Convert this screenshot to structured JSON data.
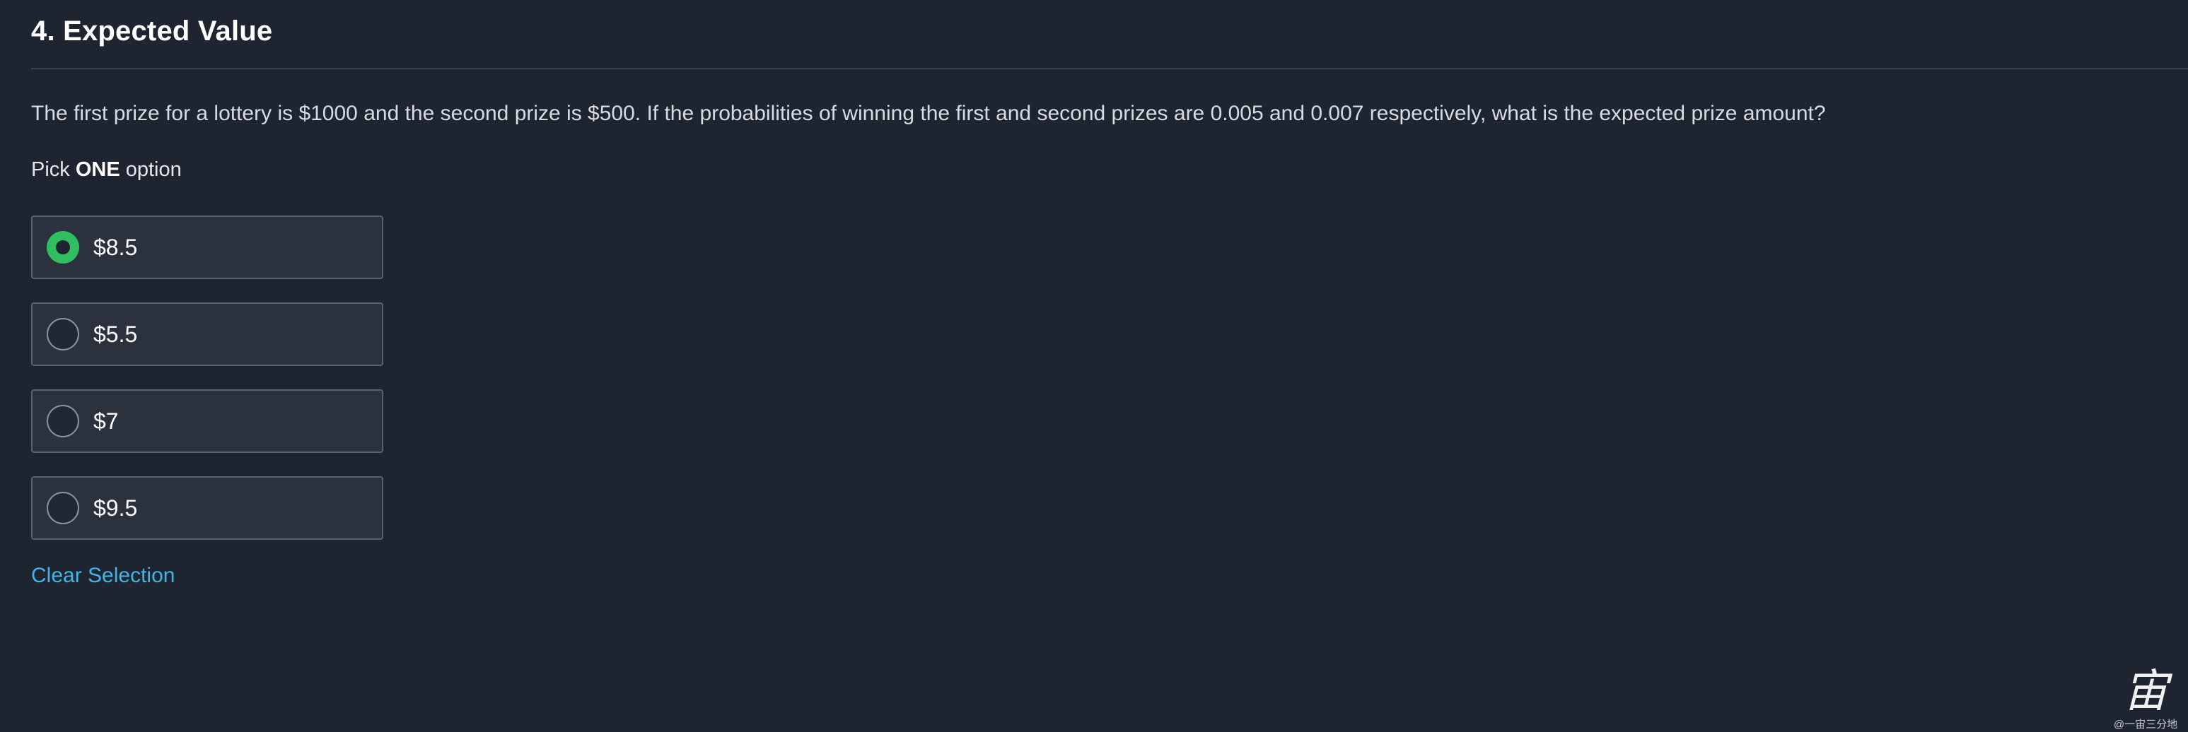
{
  "question": {
    "title": "4. Expected Value",
    "text": "The first prize for a lottery is $1000 and the second prize is $500. If the probabilities of winning the first and second prizes are 0.005 and 0.007 respectively, what is the expected prize amount?",
    "instruction_prefix": "Pick ",
    "instruction_strong": "ONE",
    "instruction_suffix": " option"
  },
  "options": [
    {
      "label": "$8.5",
      "selected": true
    },
    {
      "label": "$5.5",
      "selected": false
    },
    {
      "label": "$7",
      "selected": false
    },
    {
      "label": "$9.5",
      "selected": false
    }
  ],
  "actions": {
    "clear_label": "Clear Selection"
  },
  "watermark": {
    "glyph": "宙",
    "handle": "@一宙三分地"
  },
  "colors": {
    "background": "#1f2431",
    "option_bg": "#2c313e",
    "selected_radio": "#2fbf60",
    "link": "#3fb6e8"
  }
}
